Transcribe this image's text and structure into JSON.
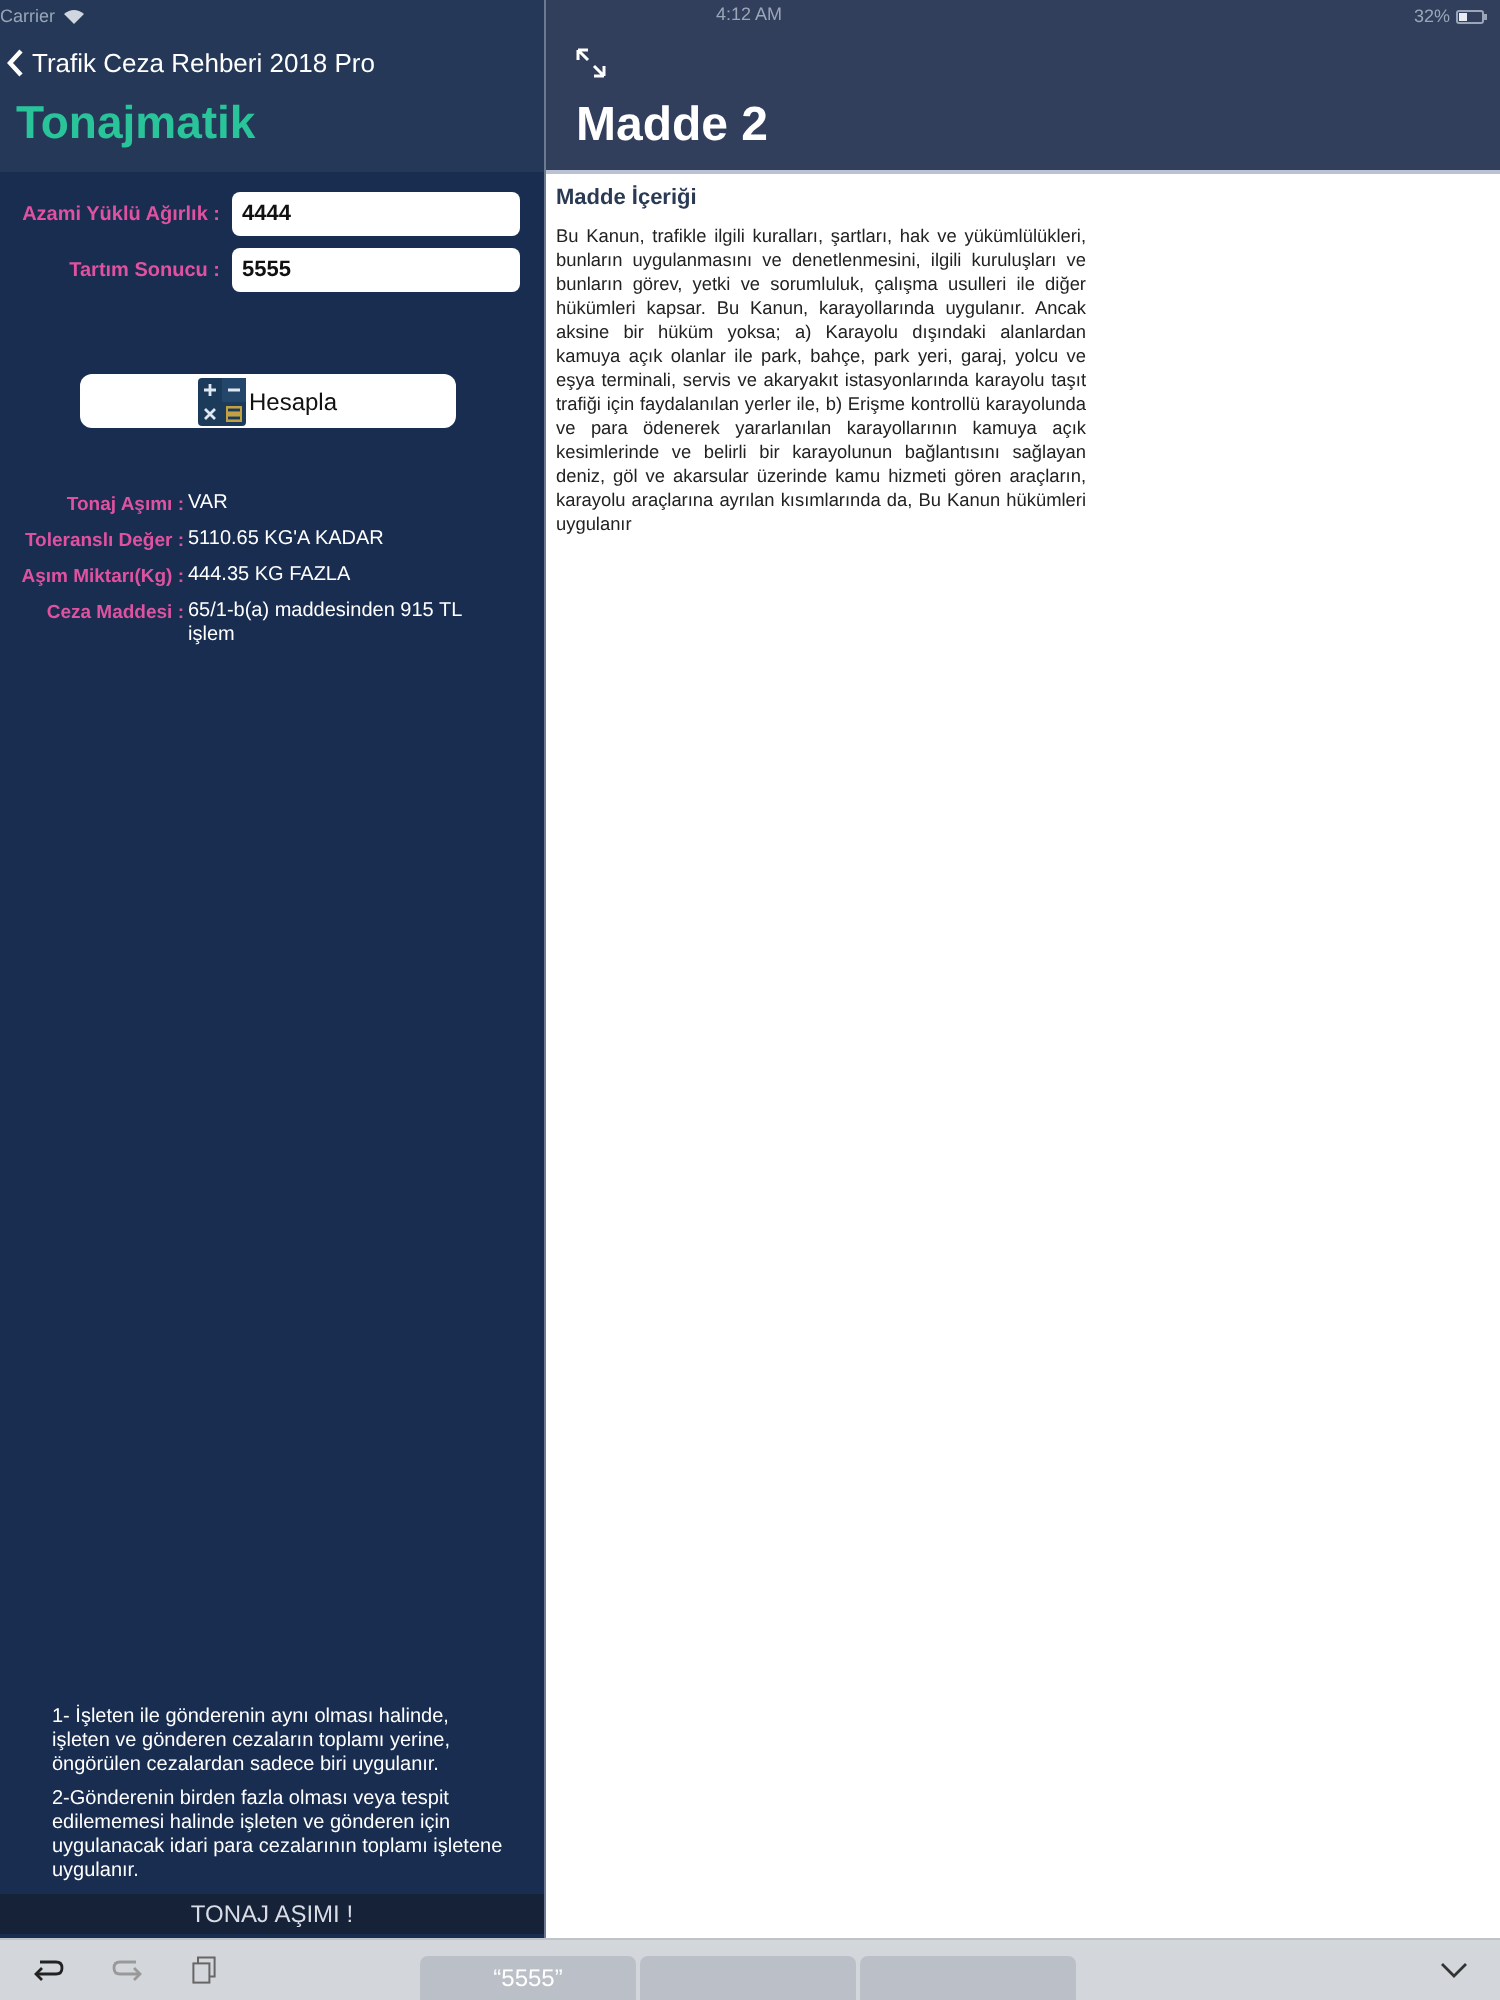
{
  "status_bar": {
    "carrier": "Carrier",
    "time": "4:12 AM",
    "battery": "32%"
  },
  "left_panel": {
    "back_label": "Trafik Ceza Rehberi 2018 Pro",
    "title": "Tonajmatik",
    "fields": [
      {
        "label": "Azami Yüklü Ağırlık :",
        "value": "4444"
      },
      {
        "label": "Tartım Sonucu :",
        "value": "5555"
      }
    ],
    "button": "Hesapla",
    "results": [
      {
        "label": "Tonaj Aşımı :",
        "value": "VAR"
      },
      {
        "label": "Toleranslı Değer :",
        "value": "5110.65 KG'A KADAR"
      },
      {
        "label": "Aşım Miktarı(Kg) :",
        "value": "444.35 KG FAZLA"
      },
      {
        "label": "Ceza Maddesi :",
        "value": "65/1-b(a) maddesinden 915 TL işlem"
      }
    ],
    "notes": [
      "1- İşleten ile gönderenin aynı olması halinde, işleten ve gönderen cezaların toplamı yerine, öngörülen cezalardan sadece biri uygulanır.",
      "2-Gönderenin birden fazla olması veya tespit edilememesi halinde işleten ve gönderen için uygulanacak idari para cezalarının toplamı işletene uygulanır."
    ],
    "toast": "TONAJ AŞIMI !"
  },
  "right_panel": {
    "title": "Madde 2",
    "section_heading": "Madde İçeriği",
    "body": "Bu Kanun, trafikle ilgili kuralları, şartları, hak ve yükümlülükleri, bunların uygulanmasını ve denetlenmesini, ilgili kuruluşları ve bunların görev, yetki ve sorumluluk, çalışma usulleri ile diğer hükümleri kapsar. Bu Kanun, karayollarında uygulanır. Ancak aksine bir hüküm yoksa; a) Karayolu dışındaki alanlardan kamuya açık olanlar ile park, bahçe, park yeri, garaj, yolcu ve eşya terminali, servis ve akaryakıt istasyonlarında karayolu taşıt trafiği için faydalanılan yerler ile, b) Erişme kontrollü karayolunda ve para ödenerek yararlanılan karayollarının kamuya açık kesimlerinde ve belirli bir karayolunun bağlantısını sağlayan deniz, göl ve akarsular üzerinde kamu hizmeti gören araçların, karayolu araçlarına ayrılan kısımlarında da, Bu Kanun hükümleri uygulanır"
  },
  "keyboard_toolbar": {
    "suggestions": [
      "“5555”"
    ]
  }
}
